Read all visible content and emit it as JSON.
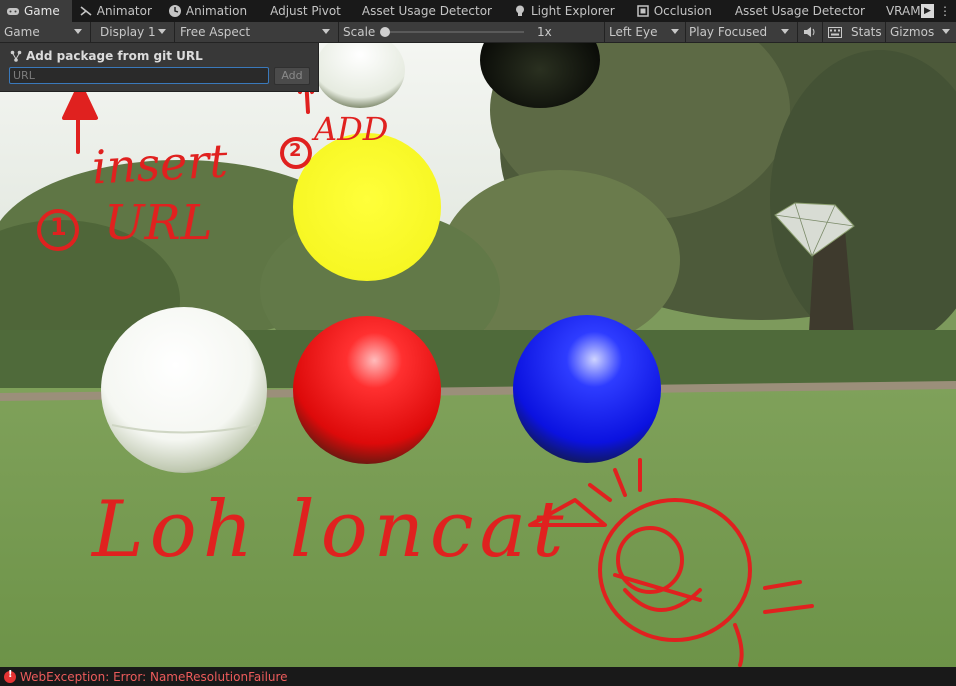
{
  "tabs": [
    {
      "label": "Game",
      "icon": "gamepad-icon",
      "active": true
    },
    {
      "label": "Animator",
      "icon": "animator-icon"
    },
    {
      "label": "Animation",
      "icon": "clock-icon"
    },
    {
      "label": "Adjust Pivot",
      "icon": ""
    },
    {
      "label": "Asset Usage Detector",
      "icon": ""
    },
    {
      "label": "Light Explorer",
      "icon": "lightbulb-icon"
    },
    {
      "label": "Occlusion",
      "icon": "occlusion-icon"
    },
    {
      "label": "Asset Usage Detector",
      "icon": ""
    },
    {
      "label": "VRAM Ca",
      "icon": ""
    }
  ],
  "toolbar": {
    "view_mode": "Game",
    "display": "Display 1",
    "aspect": "Free Aspect",
    "scale_label": "Scale",
    "scale_value": "1x",
    "eye": "Left Eye",
    "play_mode": "Play Focused",
    "stats": "Stats",
    "gizmos": "Gizmos"
  },
  "popup": {
    "title": "Add package from git URL",
    "url_placeholder": "URL",
    "add_label": "Add"
  },
  "annotations": {
    "step1": "insert",
    "step1b": "URL",
    "step1_num": "1",
    "step2": "ADD",
    "step2_num": "2",
    "scribble": "Loh loncat"
  },
  "status": {
    "error": "WebException: Error: NameResolutionFailure"
  },
  "colors": {
    "tabbar_bg": "#191919",
    "toolbar_bg": "#3c3c3c",
    "error_red": "#ec5b5b",
    "annotation_red": "#e0211f",
    "focus_blue": "#3a79bb"
  }
}
